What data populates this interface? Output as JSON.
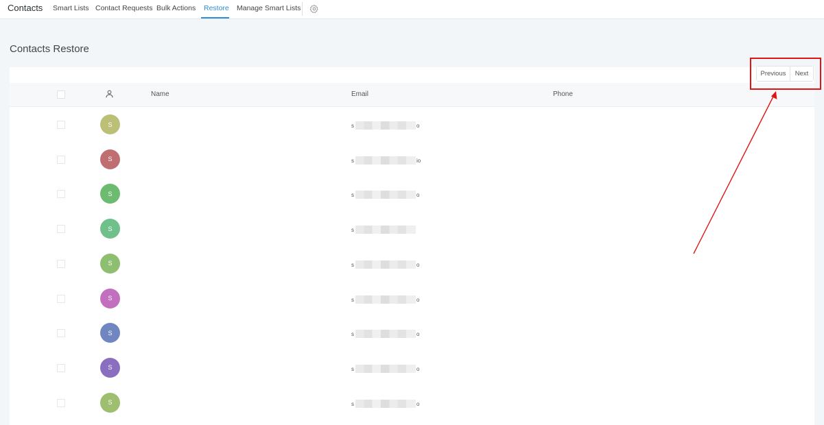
{
  "nav": {
    "brand": "Contacts",
    "tabs": [
      {
        "label": "Smart Lists"
      },
      {
        "label": "Contact Requests"
      },
      {
        "label": "Bulk Actions"
      },
      {
        "label": "Restore"
      },
      {
        "label": "Manage Smart Lists"
      }
    ],
    "active_tab": "Restore",
    "settings_icon": "gear-icon"
  },
  "page": {
    "title": "Contacts Restore"
  },
  "pagination": {
    "previous_label": "Previous",
    "next_label": "Next"
  },
  "table": {
    "columns": {
      "name": "Name",
      "email": "Email",
      "phone": "Phone"
    },
    "rows": [
      {
        "initial": "S",
        "color": "#bcbf76",
        "email_prefix": "s",
        "email_suffix": "o"
      },
      {
        "initial": "S",
        "color": "#bf6f72",
        "email_prefix": "s",
        "email_suffix": "io"
      },
      {
        "initial": "S",
        "color": "#6dbb71",
        "email_prefix": "s",
        "email_suffix": "o"
      },
      {
        "initial": "S",
        "color": "#6fc08b",
        "email_prefix": "s",
        "email_suffix": ""
      },
      {
        "initial": "S",
        "color": "#8ebf70",
        "email_prefix": "s",
        "email_suffix": "o"
      },
      {
        "initial": "S",
        "color": "#c26fbf",
        "email_prefix": "s",
        "email_suffix": "o"
      },
      {
        "initial": "S",
        "color": "#6f86c0",
        "email_prefix": "s",
        "email_suffix": "o"
      },
      {
        "initial": "S",
        "color": "#8a6fc0",
        "email_prefix": "s",
        "email_suffix": "o"
      },
      {
        "initial": "S",
        "color": "#9ebf6f",
        "email_prefix": "s",
        "email_suffix": "o"
      }
    ]
  },
  "colors": {
    "accent": "#2d8ed8",
    "annotation": "#e01414"
  }
}
